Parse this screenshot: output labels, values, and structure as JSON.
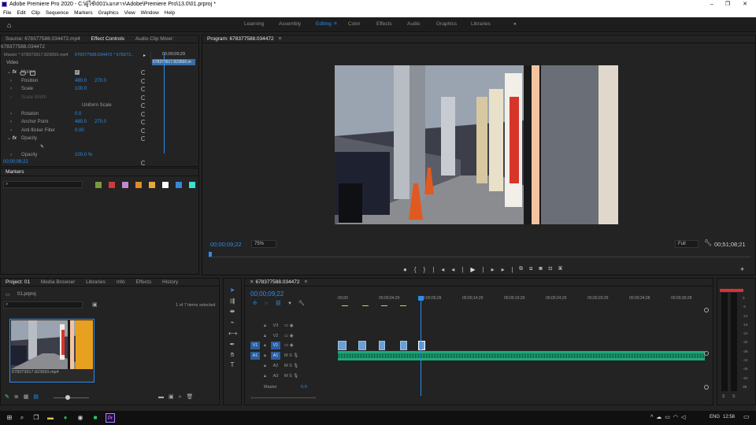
{
  "window": {
    "title": "Adobe Premiere Pro 2020 - C:\\ผู้ใช้\\001\\เอกสาร\\Adobe\\Premiere Pro\\13.0\\01.prproj *"
  },
  "menu": [
    "File",
    "Edit",
    "Clip",
    "Sequence",
    "Markers",
    "Graphics",
    "View",
    "Window",
    "Help"
  ],
  "workspaces": [
    "Learning",
    "Assembly",
    "Editing",
    "Color",
    "Effects",
    "Audio",
    "Graphics",
    "Libraries"
  ],
  "source_panel": {
    "tabs": [
      "Source: 678377588.034472.mp4",
      "Effect Controls",
      "Audio Clip Mixer: 678377588.034472"
    ],
    "master_label": "Master * 678373917.823650.mp4",
    "clip_label": "678377588.034472 * 678373...",
    "ruler_time": "00;00;09;29",
    "clip_name": "678373917.823650.m",
    "video_label": "Video",
    "effects": [
      {
        "name": "Motion",
        "type": "group"
      },
      {
        "name": "Position",
        "v1": "480.0",
        "v2": "270.0"
      },
      {
        "name": "Scale",
        "v1": "100.0",
        "v2": ""
      },
      {
        "name": "Scale Width",
        "v1": "",
        "v2": "",
        "dim": true
      },
      {
        "name": "",
        "v1": "",
        "v2": "",
        "check": "Uniform Scale"
      },
      {
        "name": "Rotation",
        "v1": "0.0",
        "v2": ""
      },
      {
        "name": "Anchor Point",
        "v1": "480.0",
        "v2": "270.0"
      },
      {
        "name": "Anti-flicker Filter",
        "v1": "0.00",
        "v2": ""
      },
      {
        "name": "Opacity",
        "type": "group"
      },
      {
        "name": "",
        "v1": "",
        "v2": "",
        "shapes": true
      },
      {
        "name": "Opacity",
        "v1": "100.0 %",
        "v2": ""
      }
    ],
    "time": "00;00;09;22"
  },
  "markers": {
    "tab": "Markers",
    "colors": [
      "#7a9a3a",
      "#d03a3a",
      "#c08acb",
      "#e08a2a",
      "#e8a83a",
      "#ffffff",
      "#3a86d8",
      "#3ae0d0"
    ]
  },
  "program": {
    "tab": "Program: 678377588.034472",
    "timecode": "00;00;09;22",
    "zoom": "75%",
    "quality": "Full",
    "duration": "00;51;08;21"
  },
  "project": {
    "tabs": [
      "Project: 01",
      "Media Browser",
      "Libraries",
      "Info",
      "Effects",
      "History"
    ],
    "file": "01.prproj",
    "items_count": "1 of 7 items selected",
    "clip_name": "678373917.823650.mp4"
  },
  "timeline": {
    "tab": "678377588.034472",
    "timecode": "00;00;09;22",
    "ruler": [
      ":00;00",
      "00;00;04;29",
      "00;00;09;29",
      "00;00;14;29",
      "00;00;19;29",
      "00;00;24;29",
      "00;00;29;29",
      "00;00;34;28",
      "00;00;39;28"
    ],
    "tracks": [
      {
        "id": "V3"
      },
      {
        "id": "V2"
      },
      {
        "id": "V1",
        "target": "V1"
      },
      {
        "id": "A1",
        "target": "A1"
      },
      {
        "id": "A2"
      },
      {
        "id": "A3"
      }
    ],
    "master": "Master",
    "master_value": "0.0"
  },
  "meter": {
    "labels": [
      "0",
      "-6",
      "-12",
      "-18",
      "-24",
      "-30",
      "-36",
      "-42",
      "-48",
      "-54",
      "dB"
    ],
    "solo": "S",
    "solo2": "S"
  },
  "taskbar": {
    "lang": "ENG",
    "time": "12:58"
  }
}
